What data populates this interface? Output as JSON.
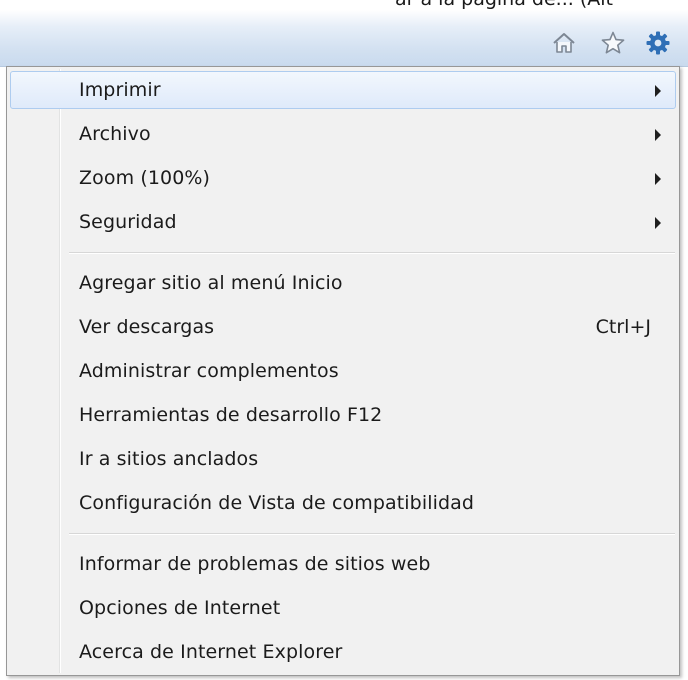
{
  "page": {
    "clipped_top_text": "ar a la página de... (Alt"
  },
  "toolbar": {
    "icons": [
      "home-icon",
      "star-icon",
      "gear-icon"
    ]
  },
  "menu": {
    "items": [
      {
        "label": "Imprimir",
        "has_submenu": true,
        "highlighted": true
      },
      {
        "label": "Archivo",
        "has_submenu": true
      },
      {
        "label": "Zoom (100%)",
        "has_submenu": true
      },
      {
        "label": "Seguridad",
        "has_submenu": true
      },
      {
        "label": "Agregar sitio al menú Inicio"
      },
      {
        "label": "Ver descargas",
        "shortcut": "Ctrl+J"
      },
      {
        "label": "Administrar complementos"
      },
      {
        "label": "Herramientas de desarrollo F12"
      },
      {
        "label": "Ir a sitios anclados"
      },
      {
        "label": "Configuración de Vista de compatibilidad"
      },
      {
        "label": "Informar de problemas de sitios web"
      },
      {
        "label": "Opciones de Internet"
      },
      {
        "label": "Acerca de Internet Explorer"
      }
    ]
  },
  "colors": {
    "menu_background": "#f1f1f1",
    "highlight_border": "#aeccef",
    "gear_blue": "#2f6fb6"
  }
}
